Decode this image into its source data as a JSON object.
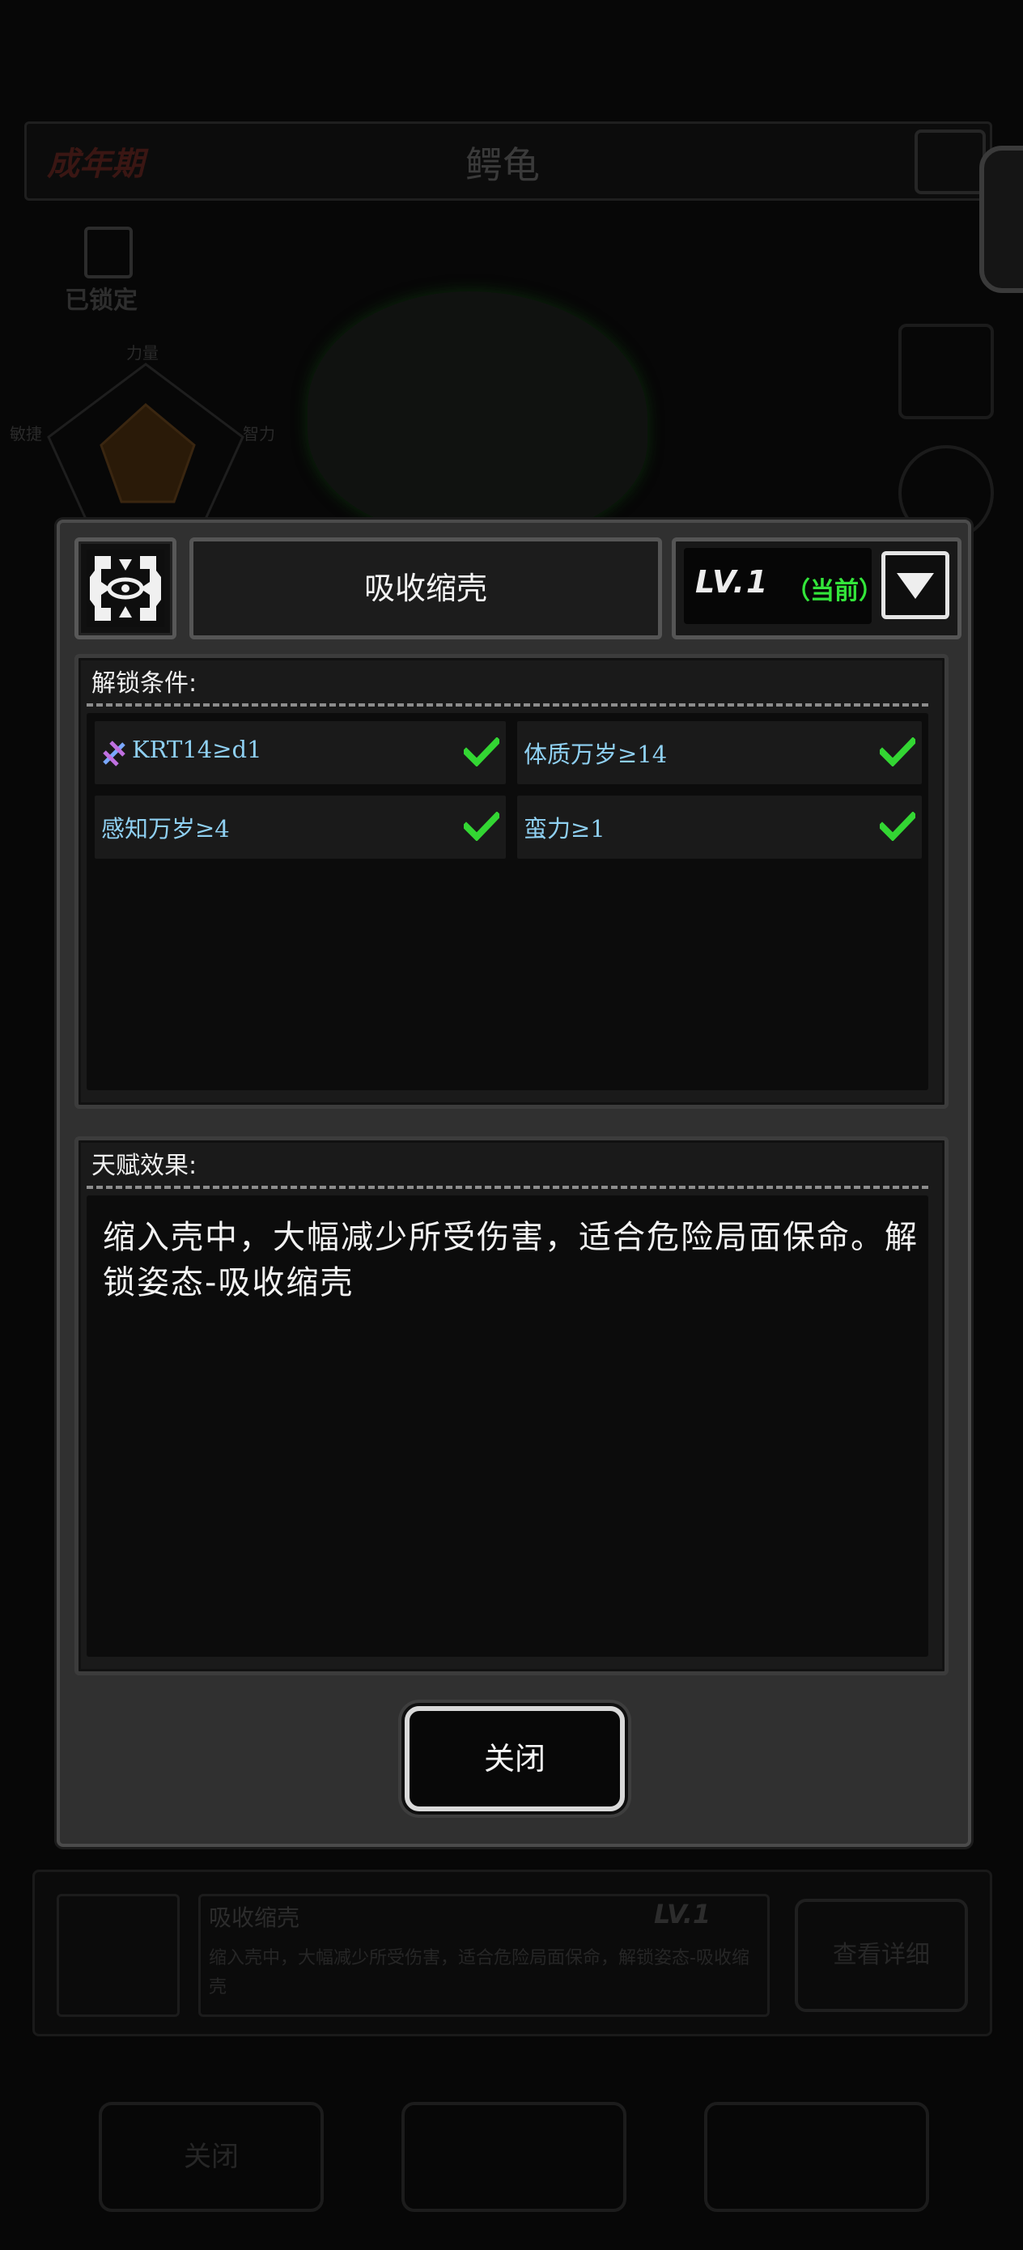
{
  "background": {
    "stage": "成年期",
    "creature_name": "鳄龟",
    "lock_status": "已锁定",
    "radar_stats": [
      "力量",
      "敏捷",
      "智力"
    ],
    "skill": {
      "name": "吸收缩壳",
      "level": "LV.1",
      "description": "缩入壳中，大幅减少所受伤害，适合危险局面保命，解锁姿态-吸收缩壳",
      "detail_button": "查看详细"
    },
    "bottom_close": "关闭"
  },
  "modal": {
    "talent_icon": "talent-rune-icon",
    "title": "吸收缩壳",
    "level": "LV.1",
    "level_current": "（当前）",
    "unlock": {
      "title": "解锁条件:",
      "conditions": [
        {
          "text": "KRT14≥d1",
          "icon": "dna-icon",
          "met": true
        },
        {
          "text": "体质万岁≥14",
          "met": true
        },
        {
          "text": "感知万岁≥4",
          "met": true
        },
        {
          "text": "蛮力≥1",
          "met": true
        }
      ]
    },
    "effect": {
      "title": "天赋效果:",
      "text": "缩入壳中，大幅减少所受伤害，适合危险局面保命。解锁姿态-吸收缩壳"
    },
    "close_label": "关闭"
  },
  "colors": {
    "check": "#33d633",
    "condition_text": "#8fd0f2",
    "current_badge": "#33e53a"
  }
}
